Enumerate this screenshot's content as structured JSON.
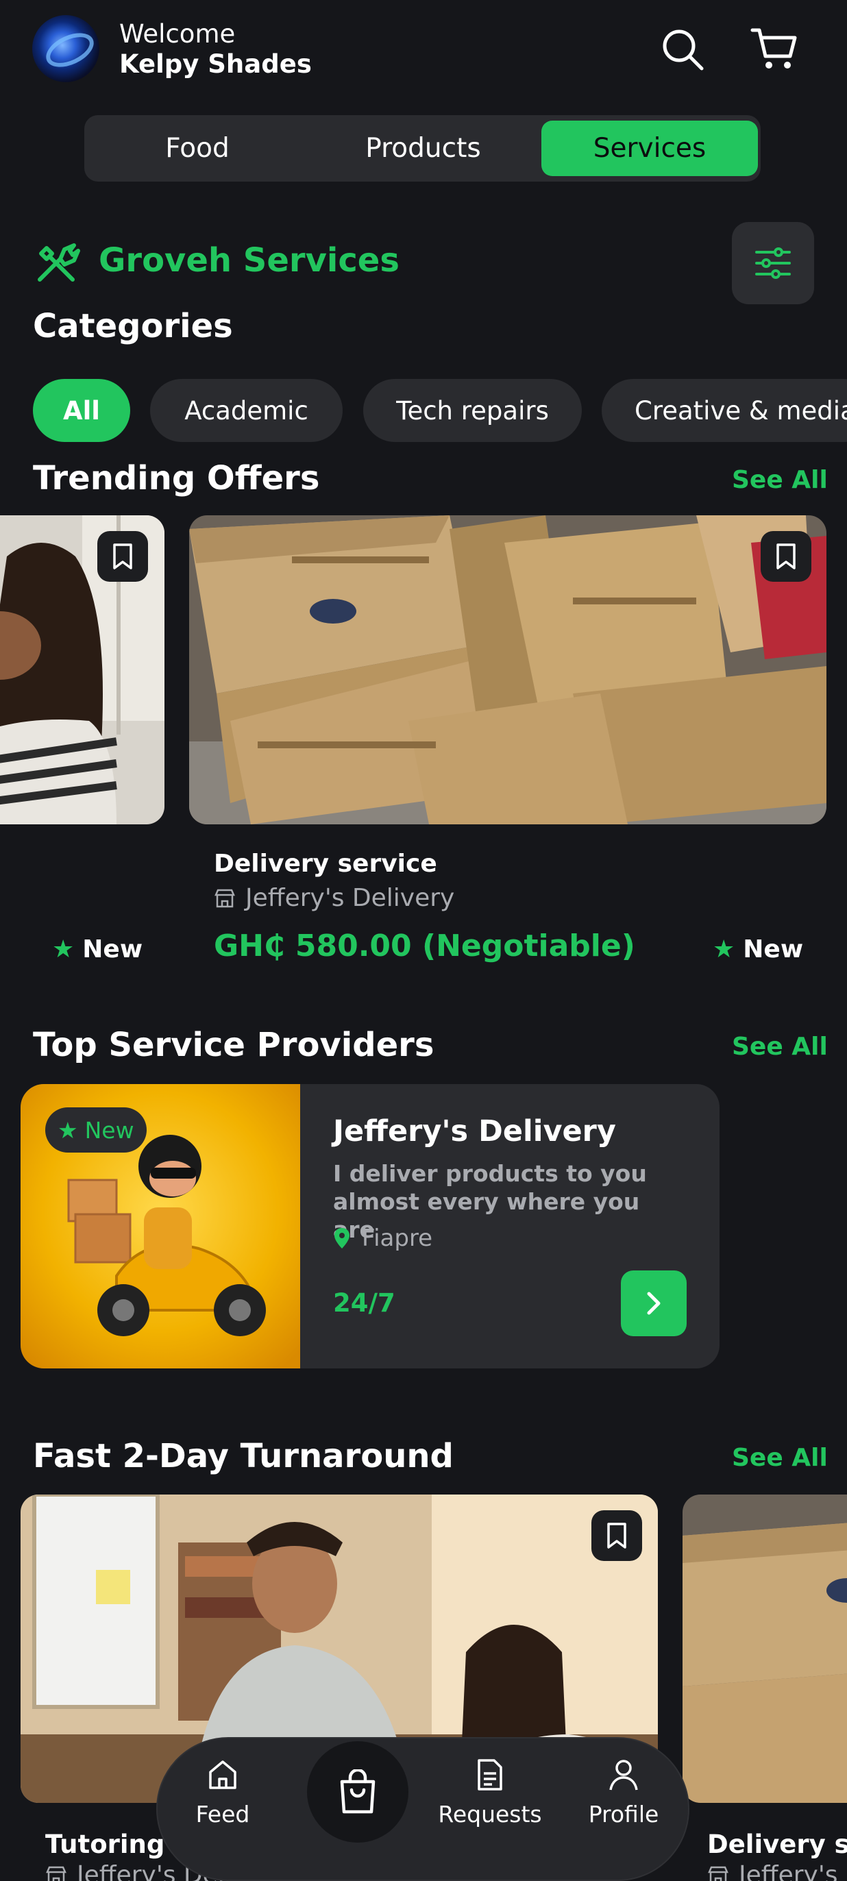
{
  "header": {
    "welcome": "Welcome",
    "user_name": "Kelpy Shades"
  },
  "tabs": [
    {
      "label": "Food",
      "active": false
    },
    {
      "label": "Products",
      "active": false
    },
    {
      "label": "Services",
      "active": true
    }
  ],
  "brand": {
    "title": "Groveh Services",
    "icon": "tools-icon",
    "accent": "#22c55e"
  },
  "categories": {
    "title": "Categories",
    "items": [
      "All",
      "Academic",
      "Tech repairs",
      "Creative & media"
    ],
    "selected": "All"
  },
  "trending": {
    "title": "Trending Offers",
    "see_all": "See All",
    "left_tag": "New",
    "right_tag": "New",
    "offer": {
      "title": "Delivery service",
      "provider": "Jeffery's Delivery",
      "price": "GH₵ 580.00 (Negotiable)"
    }
  },
  "providers": {
    "title": "Top Service Providers",
    "see_all": "See All",
    "card": {
      "badge": "New",
      "name": "Jeffery's Delivery",
      "description": "I deliver products to you almost every where you are",
      "location": "Fiapre",
      "hours": "24/7"
    }
  },
  "turnaround": {
    "title": "Fast 2-Day Turnaround",
    "see_all": "See All",
    "card1": {
      "title": "Tutoring",
      "provider": "Jeffery's Delivery"
    },
    "card2": {
      "title": "Delivery ser",
      "provider": "Jeffery's"
    }
  },
  "nav": {
    "feed": "Feed",
    "requests": "Requests",
    "profile": "Profile"
  }
}
